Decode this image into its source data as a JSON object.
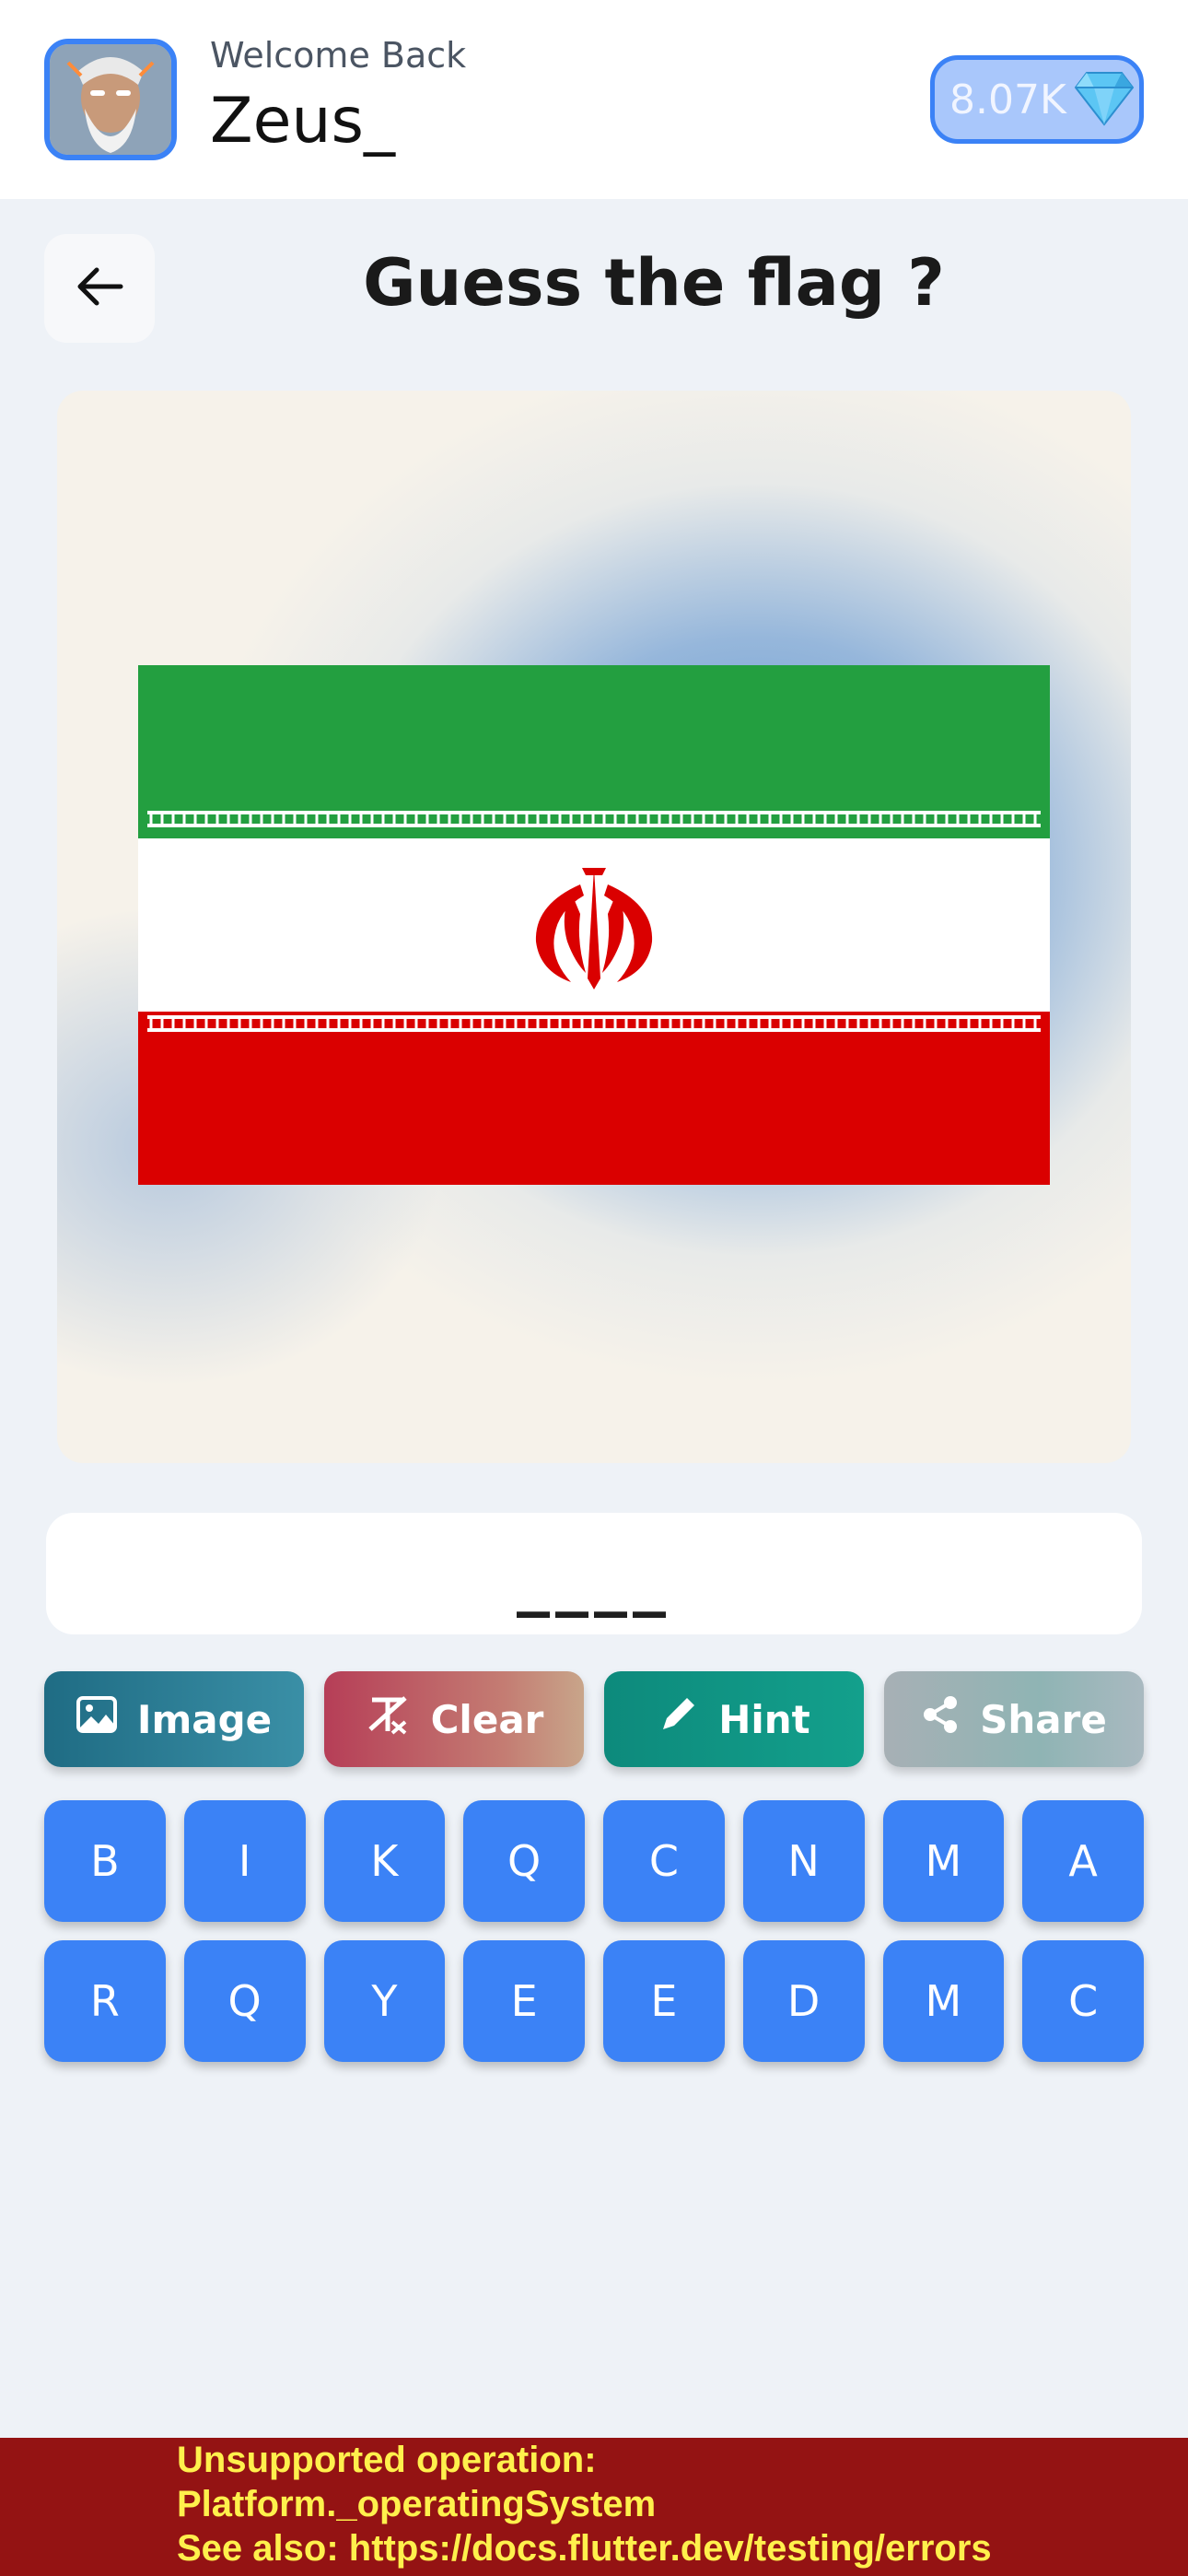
{
  "header": {
    "welcome": "Welcome Back",
    "username": "Zeus_",
    "gems": "8.07K",
    "gem_icon": "diamond-icon"
  },
  "title": {
    "back_icon": "arrow-left-icon",
    "text": "Guess the flag ?"
  },
  "flag": {
    "country_colors": [
      "#239f40",
      "#ffffff",
      "#da0000"
    ]
  },
  "answer": {
    "text": "____"
  },
  "actions": [
    {
      "label": "Image",
      "icon": "image-icon"
    },
    {
      "label": "Clear",
      "icon": "clear-format-icon"
    },
    {
      "label": "Hint",
      "icon": "pencil-icon"
    },
    {
      "label": "Share",
      "icon": "share-icon"
    }
  ],
  "keyboard": {
    "row1": [
      "B",
      "I",
      "K",
      "Q",
      "C",
      "N",
      "M",
      "A"
    ],
    "row2": [
      "R",
      "Q",
      "Y",
      "E",
      "E",
      "D",
      "M",
      "C"
    ]
  },
  "error": {
    "message": "Unsupported operation:\nPlatform._operatingSystem\nSee also: https://docs.flutter.dev/testing/errors"
  },
  "colors": {
    "accent": "#3b82f6",
    "error_bg": "#941313",
    "error_text": "#fff04c"
  }
}
